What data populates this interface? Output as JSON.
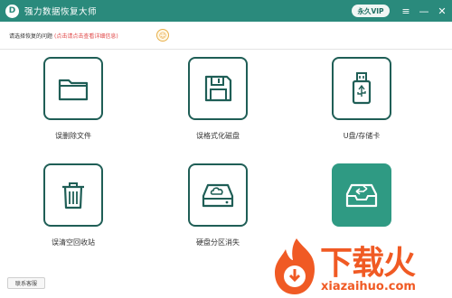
{
  "titlebar": {
    "app_title": "强力数据恢复大师",
    "logo_glyph": "D",
    "vip_label": "永久VIP",
    "menu_glyph": "≡",
    "minimize_glyph": "—",
    "close_glyph": "✕"
  },
  "hint": {
    "text": "请选择恢复的问题",
    "link": "(点击请点击查看详细信息)",
    "icon_glyph": "☺"
  },
  "cards": [
    {
      "label": "误删除文件",
      "icon": "folder-icon"
    },
    {
      "label": "误格式化磁盘",
      "icon": "floppy-disk-icon"
    },
    {
      "label": "U盘/存储卡",
      "icon": "usb-drive-icon"
    },
    {
      "label": "误清空回收站",
      "icon": "trash-icon"
    },
    {
      "label": "硬盘分区消失",
      "icon": "cloud-disk-icon"
    },
    {
      "label": "",
      "icon": "inbox-transfer-icon"
    }
  ],
  "footer": {
    "contact_label": "联系客服"
  },
  "watermark": {
    "title": "下载火",
    "url": "xiazaihuo.com"
  },
  "colors": {
    "titlebar": "#2a8a7c",
    "card_border": "#1f5e56",
    "card_active": "#2f9a83",
    "hint_link": "#e04747",
    "watermark": "#f05a24"
  }
}
